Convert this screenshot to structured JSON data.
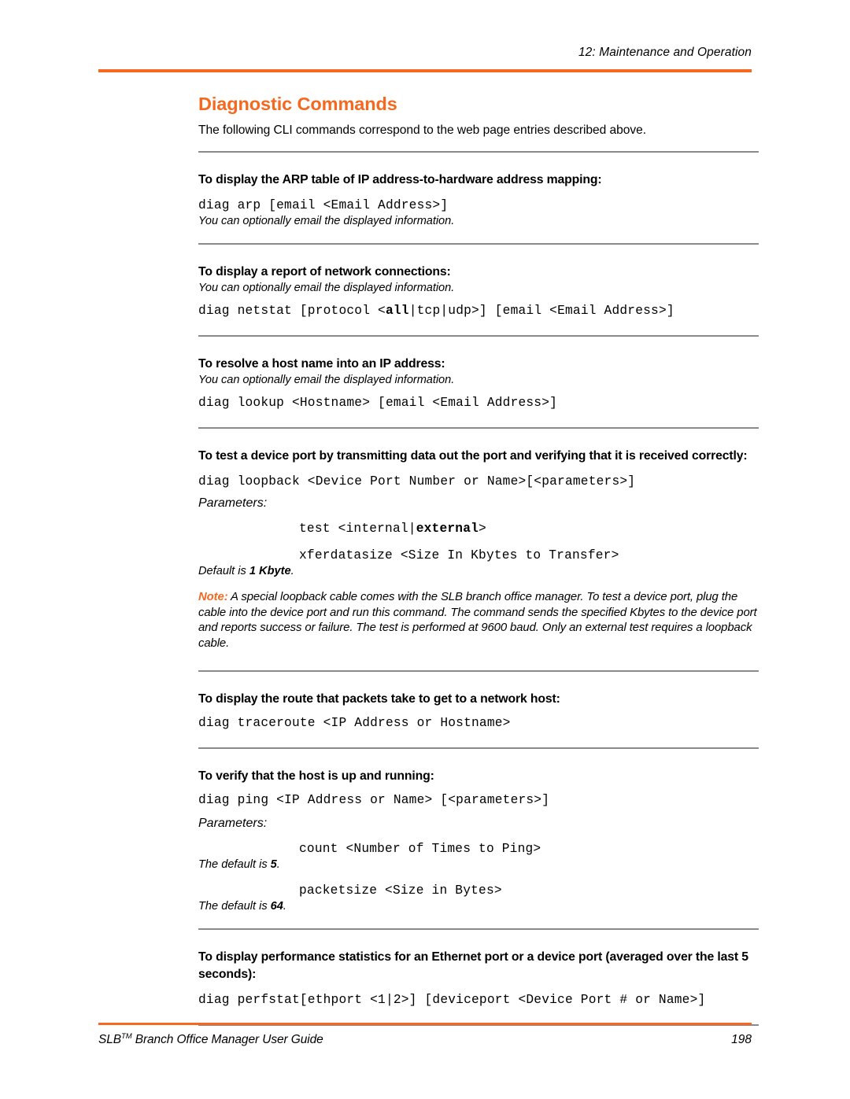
{
  "header": {
    "chapter": "12: Maintenance and Operation",
    "rule_color": "#F4681F"
  },
  "section": {
    "title": "Diagnostic Commands",
    "title_color": "#F4681F",
    "intro": "The following CLI commands correspond to the web page entries described above."
  },
  "commands": [
    {
      "heading": "To display the ARP table of IP address-to-hardware address mapping:",
      "syntax": "diag arp [email <Email Address>]",
      "note_after": "You can optionally email the displayed information."
    },
    {
      "heading": "To display a report of network connections:",
      "note_before": "You can optionally email the displayed information.",
      "syntax_pre": "diag netstat [protocol <",
      "syntax_bold": "all",
      "syntax_post": "|tcp|udp>] [email <Email Address>]"
    },
    {
      "heading": "To resolve a host name into an IP address:",
      "note_before": "You can optionally email the displayed information.",
      "syntax": "diag lookup <Hostname> [email <Email Address>]"
    },
    {
      "heading": "To test a device port by transmitting data out the port and verifying that it is received correctly:",
      "syntax": "diag loopback <Device Port Number or Name>[<parameters>]",
      "params_label": "Parameters:",
      "param1_pre": "test <internal|",
      "param1_bold": "external",
      "param1_post": ">",
      "param2": "xferdatasize <Size In Kbytes to Transfer>",
      "param2_default_pre": "Default is ",
      "param2_default_bold": "1 Kbyte",
      "param2_default_post": ".",
      "note_label": "Note:",
      "note_body": " A special loopback cable comes with the SLB branch office manager. To test a device port, plug the cable into the device port and run this command. The command sends the specified Kbytes to the device port and reports success or failure. The test is performed at 9600 baud. Only an external test requires a loopback cable."
    },
    {
      "heading": "To display the route that packets take to get to a network host:",
      "syntax": "diag traceroute <IP Address or Hostname>"
    },
    {
      "heading": "To verify that the host is up and running:",
      "syntax": "diag ping <IP Address or Name> [<parameters>]",
      "params_label": "Parameters:",
      "param1": "count <Number of Times to Ping>",
      "param1_default_pre": "The default is ",
      "param1_default_bold": "5",
      "param1_default_post": ".",
      "param2": "packetsize <Size in Bytes>",
      "param2_default_pre": "The default is ",
      "param2_default_bold": "64",
      "param2_default_post": "."
    },
    {
      "heading": "To display performance statistics for an Ethernet port or a device port (averaged over the last 5 seconds):",
      "syntax": "diag perfstat[ethport <1|2>] [deviceport <Device Port # or Name>]"
    }
  ],
  "footer": {
    "title_pre": "SLB",
    "title_tm": "TM",
    "title_post": " Branch Office Manager User Guide",
    "page_number": "198",
    "rule_color": "#F4681F"
  }
}
